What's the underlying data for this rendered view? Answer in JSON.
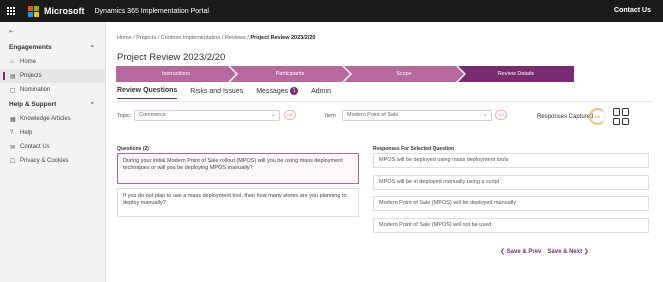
{
  "topbar": {
    "brand": "Microsoft",
    "portal": "Dynamics 365 Implementation Portal",
    "contact": "Contact Us",
    "logo_colors": [
      "#f25022",
      "#7fba00",
      "#00a4ef",
      "#ffb900"
    ]
  },
  "sidebar": {
    "collapse_icon": "collapse-icon",
    "engagements_label": "Engagements",
    "help_label": "Help & Support",
    "engagement_items": [
      {
        "label": "Home",
        "icon": "home-icon"
      },
      {
        "label": "Projects",
        "icon": "projects-icon"
      },
      {
        "label": "Nomination",
        "icon": "nomination-icon"
      }
    ],
    "help_items": [
      {
        "label": "Knowledge Articles",
        "icon": "book-icon"
      },
      {
        "label": "Help",
        "icon": "help-icon"
      },
      {
        "label": "Contact Us",
        "icon": "contact-icon"
      },
      {
        "label": "Privacy & Cookies",
        "icon": "privacy-icon"
      }
    ]
  },
  "breadcrumb": {
    "items": [
      "Home",
      "Projects",
      "Contoso Implementation",
      "Reviews"
    ],
    "current": "Project Review 2023/2/20"
  },
  "page_title": "Project Review 2023/2/20",
  "steps": [
    {
      "label": "Instructions",
      "color": "#b5699f"
    },
    {
      "label": "Participants",
      "color": "#b5699f"
    },
    {
      "label": "Scope",
      "color": "#b5699f"
    },
    {
      "label": "Review Details",
      "color": "#7a2c73"
    }
  ],
  "tabs": [
    {
      "label": "Review Questions",
      "active": true
    },
    {
      "label": "Risks and Issues",
      "active": false
    },
    {
      "label": "Messages",
      "active": false,
      "badge": "1"
    },
    {
      "label": "Admin",
      "active": false
    }
  ],
  "filters": {
    "topic_label": "Topic",
    "topic_value": "Commerce",
    "topic_btn": "0/8",
    "item_label": "Item",
    "item_value": "Modern Point of Sale",
    "item_btn": "0/2",
    "responses_label": "Responses Captured",
    "responses_ring": "0%"
  },
  "questions": {
    "header": "Questions (2)",
    "items": [
      "During your initial Modern Point of Sale rollout (MPOS) will you be using mass deployment techniques or will you be deploying MPOS manually?",
      "If you do not plan to use a mass deployment tool, then how many stores are you planning to deploy manually?"
    ]
  },
  "responses": {
    "header": "Responses For Selected Question",
    "items": [
      "MPOS will be deployed using mass deployment tools",
      "MPOS will be in deployed manually using a script",
      "Modern Point of Sale (MPOS) will be deployed manually",
      "Modern Point of Sale (MPOS) will not be used"
    ]
  },
  "nav": {
    "prev": "❮ Save & Prev",
    "next": "Save & Next ❯"
  }
}
